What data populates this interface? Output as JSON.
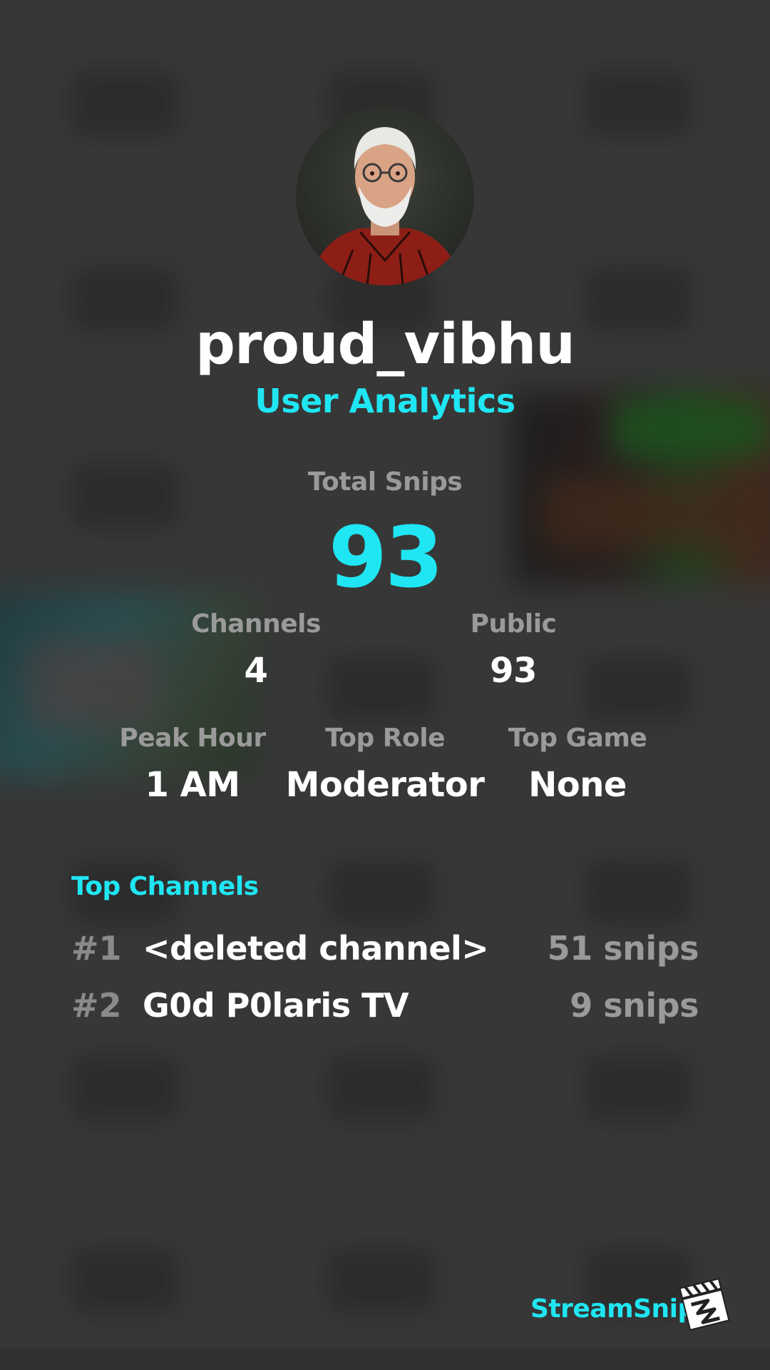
{
  "profile": {
    "username": "proud_vibhu",
    "subtitle": "User Analytics",
    "avatar_icon": "user-avatar-illustration"
  },
  "stats": {
    "total": {
      "label": "Total Snips",
      "value": "93"
    },
    "channels": {
      "label": "Channels",
      "value": "4"
    },
    "public": {
      "label": "Public",
      "value": "93"
    },
    "peak_hour": {
      "label": "Peak Hour",
      "value": "1 AM"
    },
    "top_role": {
      "label": "Top Role",
      "value": "Moderator"
    },
    "top_game": {
      "label": "Top Game",
      "value": "None"
    }
  },
  "top_channels": {
    "title": "Top Channels",
    "items": [
      {
        "rank": "#1",
        "name": "<deleted channel>",
        "count": "51 snips"
      },
      {
        "rank": "#2",
        "name": "G0d P0laris TV",
        "count": "9 snips"
      }
    ]
  },
  "brand": {
    "name": "StreamSnip",
    "logo_icon": "clapperboard-icon"
  },
  "colors": {
    "accent": "#1fe6f2",
    "background": "#3e3e3e",
    "muted_text": "#9a9a9a",
    "text": "#ffffff"
  }
}
